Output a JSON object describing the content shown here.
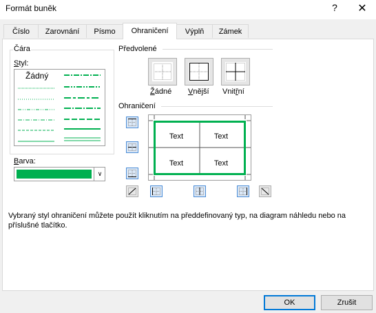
{
  "window": {
    "title": "Formát buněk",
    "help_glyph": "?",
    "close_glyph": "✕"
  },
  "tabs": [
    {
      "label": "Číslo"
    },
    {
      "label": "Zarovnání"
    },
    {
      "label": "Písmo"
    },
    {
      "label": "Ohraničení",
      "active": true
    },
    {
      "label": "Výplň"
    },
    {
      "label": "Zámek"
    }
  ],
  "line_group": {
    "label": "Čára",
    "style_label": "Styl:",
    "style_none": "Žádný",
    "color_label": "Barva:",
    "color_value": "#00b050"
  },
  "presets": {
    "label": "Předvolené",
    "items": [
      {
        "label": "Žádné"
      },
      {
        "label": "Vnější"
      },
      {
        "label": "Vnitřní"
      }
    ]
  },
  "border": {
    "label": "Ohraničení",
    "cell_text": [
      "Text",
      "Text",
      "Text",
      "Text"
    ],
    "preview_color": "#00b050"
  },
  "hint": "Vybraný styl ohraničení můžete použít kliknutím na předdefinovaný typ, na diagram náhledu nebo na příslušné tlačítko.",
  "buttons": {
    "ok": "OK",
    "cancel": "Zrušit"
  }
}
